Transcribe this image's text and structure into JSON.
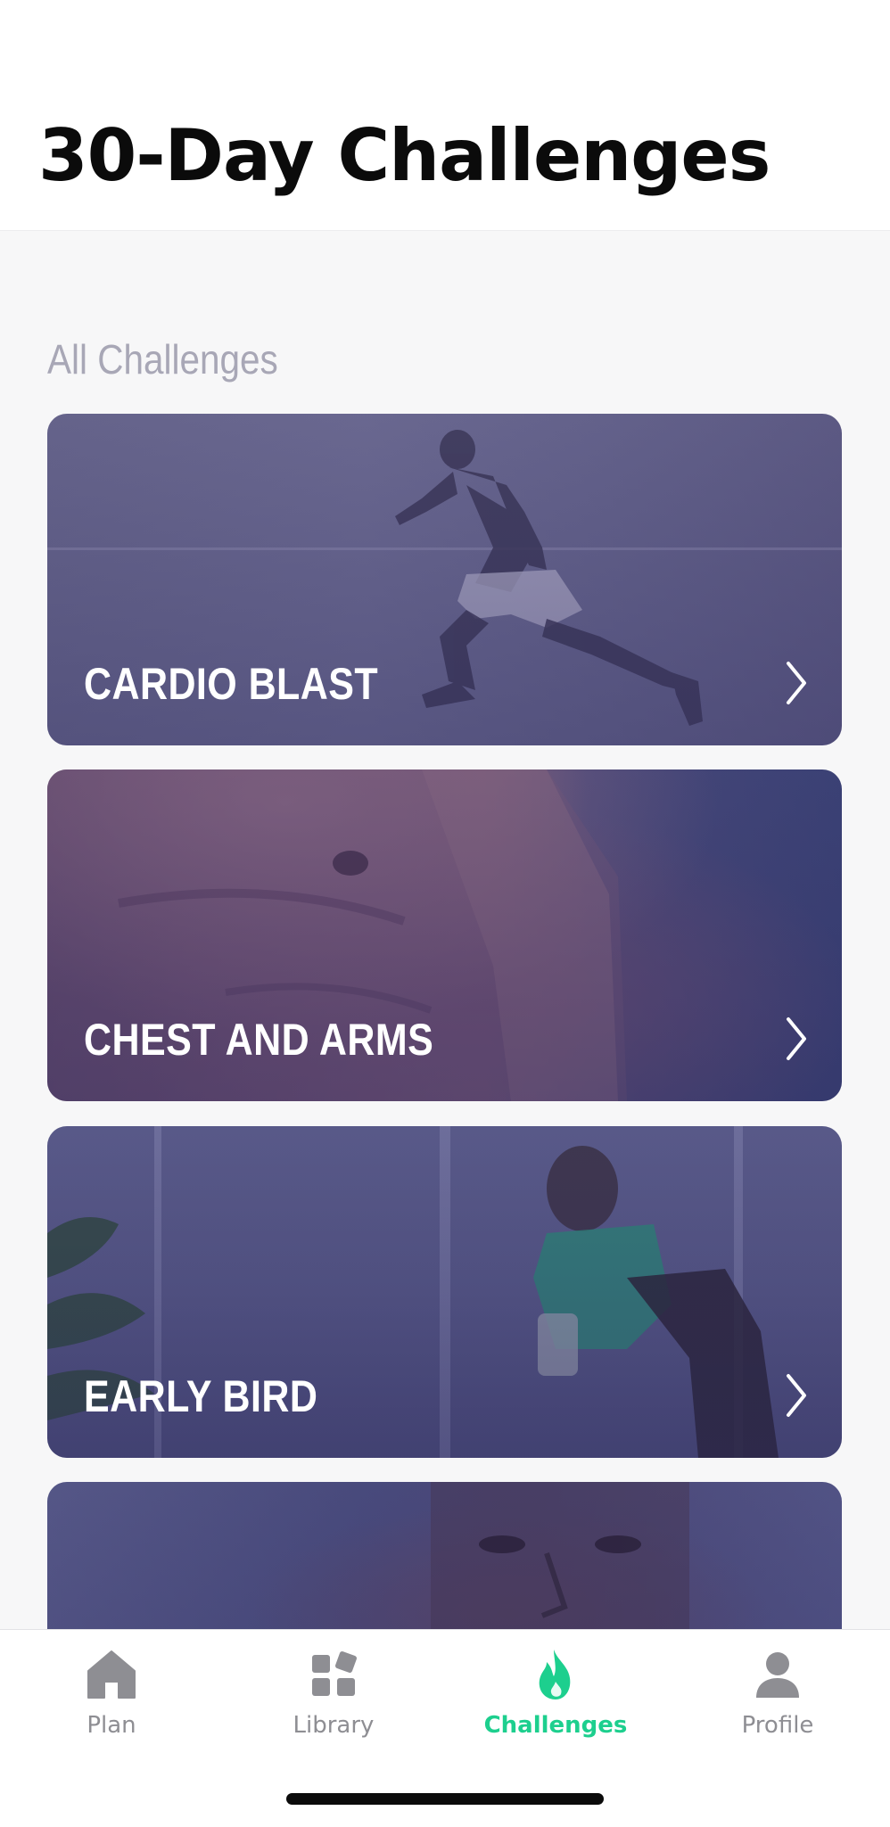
{
  "header": {
    "title": "30-Day Challenges"
  },
  "section": {
    "title": "All Challenges"
  },
  "challenges": [
    {
      "label": "CARDIO BLAST"
    },
    {
      "label": "CHEST AND ARMS"
    },
    {
      "label": "EARLY BIRD"
    },
    {
      "label": ""
    }
  ],
  "tabbar": {
    "tabs": [
      {
        "label": "Plan",
        "icon": "home-icon"
      },
      {
        "label": "Library",
        "icon": "library-icon"
      },
      {
        "label": "Challenges",
        "icon": "flame-icon",
        "active": true
      },
      {
        "label": "Profile",
        "icon": "person-icon"
      }
    ]
  },
  "colors": {
    "accent": "#1dcf8e",
    "inactive": "#8e8e93",
    "title": "#0b0b0b",
    "section": "#a8a7b6"
  }
}
